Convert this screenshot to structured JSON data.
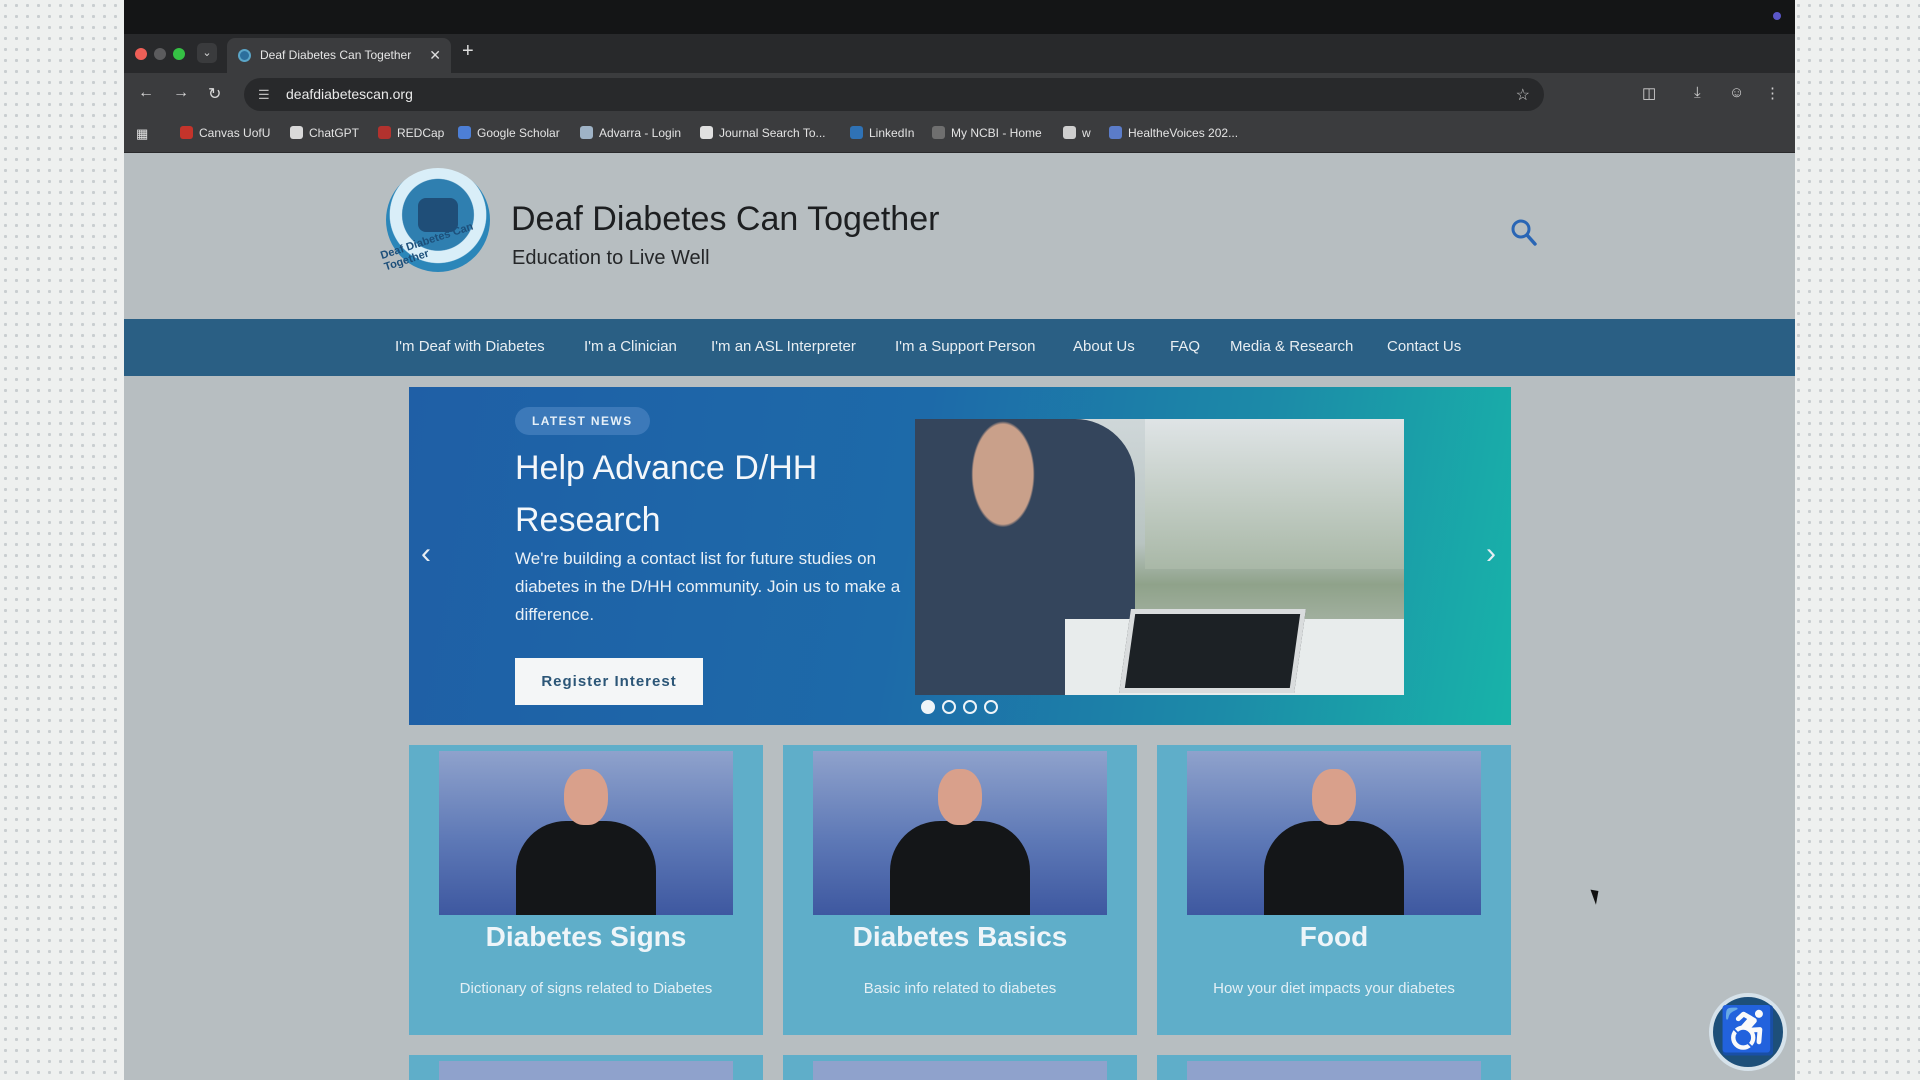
{
  "browser": {
    "tab_title": "Deaf Diabetes Can Together",
    "url": "deafdiabetescan.org",
    "bookmarks": [
      {
        "label": "Canvas UofU",
        "color": "#c4342b"
      },
      {
        "label": "ChatGPT",
        "color": "#d9d9d9"
      },
      {
        "label": "REDCap",
        "color": "#b2322e"
      },
      {
        "label": "Google Scholar",
        "color": "#4d7fd6"
      },
      {
        "label": "Advarra - Login",
        "color": "#9fb3c6"
      },
      {
        "label": "Journal Search To...",
        "color": "#e0e0e0"
      },
      {
        "label": "LinkedIn",
        "color": "#2f72b5"
      },
      {
        "label": "My NCBI - Home",
        "color": "#6f6f6f"
      },
      {
        "label": "w",
        "color": "#cfcfcf"
      },
      {
        "label": "HealtheVoices 202...",
        "color": "#5b7cc9"
      }
    ]
  },
  "site": {
    "title": "Deaf Diabetes Can Together",
    "subtitle": "Education to Live Well",
    "logo_text": "Deaf Diabetes Can Together",
    "nav": [
      "I'm Deaf with Diabetes",
      "I'm a Clinician",
      "I'm an ASL Interpreter",
      "I'm a Support Person",
      "About Us",
      "FAQ",
      "Media & Research",
      "Contact Us"
    ],
    "hero": {
      "badge": "LATEST NEWS",
      "title": "Help Advance D/HH Research",
      "text": "We're building a contact list for future studies on diabetes in the D/HH community. Join us to make a difference.",
      "button": "Register Interest",
      "slide_count": 4,
      "active_slide": 1
    },
    "cards": [
      {
        "title": "Diabetes Signs",
        "desc": "Dictionary of signs related to Diabetes"
      },
      {
        "title": "Diabetes Basics",
        "desc": "Basic info related to diabetes"
      },
      {
        "title": "Food",
        "desc": "How your diet impacts your diabetes"
      }
    ]
  },
  "colors": {
    "nav_bg": "#2a5f84",
    "card_bg": "#5faec9",
    "brand_blue": "#1d4f79"
  }
}
